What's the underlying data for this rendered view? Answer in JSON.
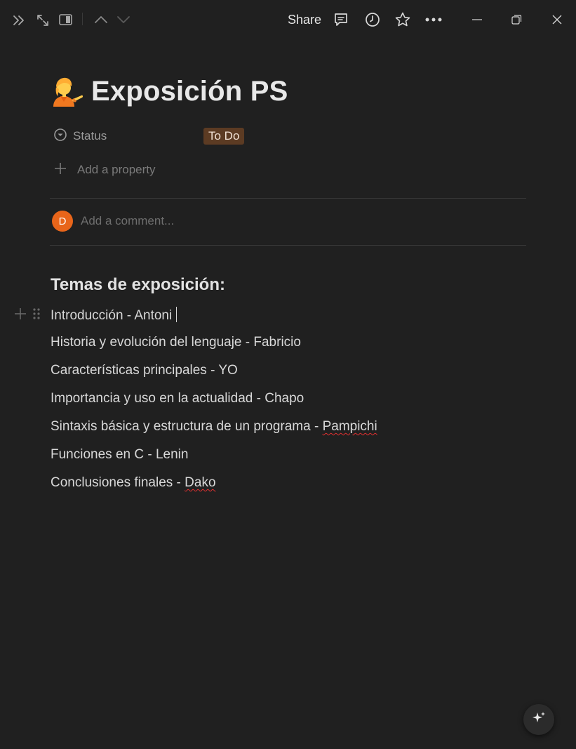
{
  "topbar": {
    "share_label": "Share",
    "icons": [
      "double-chevron-right-icon",
      "expand-icon",
      "sidebar-panel-icon",
      "chevron-up-icon",
      "chevron-down-icon",
      "comment-icon",
      "clock-icon",
      "star-icon",
      "more-icon",
      "minimize-icon",
      "restore-icon",
      "close-icon"
    ]
  },
  "page": {
    "icon": "person-tipping-hand-emoji",
    "title": "Exposición PS"
  },
  "properties": {
    "status_label": "Status",
    "status_value": "To Do",
    "status_color": "#5c3b23",
    "add_property_label": "Add a property"
  },
  "comment": {
    "avatar_initial": "D",
    "avatar_color": "#e8651a",
    "placeholder": "Add a comment..."
  },
  "content": {
    "heading": "Temas de exposición:",
    "lines": [
      {
        "text": "Introducción - Antoni"
      },
      {
        "text": "Historia y evolución del lenguaje - Fabricio"
      },
      {
        "text": "Características principales - YO"
      },
      {
        "text": "Importancia y uso en la actualidad - Chapo"
      },
      {
        "prefix": "Sintaxis básica y estructura de un programa - ",
        "flagged": "Pampichi"
      },
      {
        "text": "Funciones en C - Lenin"
      },
      {
        "prefix": "Conclusiones finales - ",
        "flagged": "Dako"
      }
    ]
  }
}
